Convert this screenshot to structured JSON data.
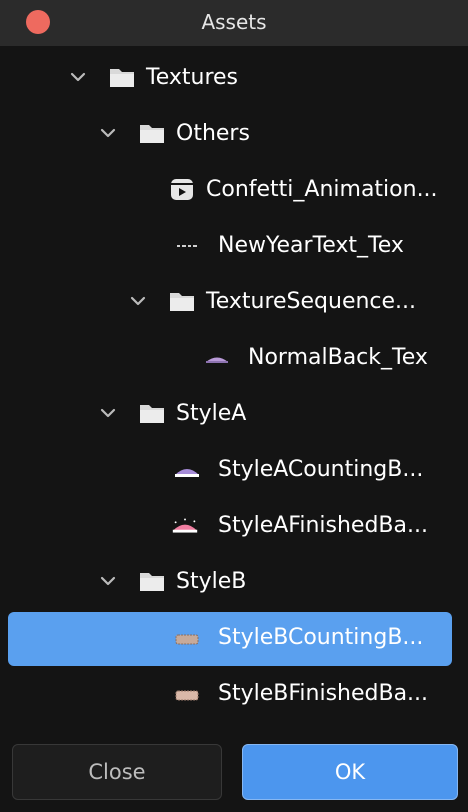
{
  "window": {
    "title": "Assets"
  },
  "tree": {
    "items": [
      {
        "label": "Textures",
        "kind": "folder",
        "expanded": true
      },
      {
        "label": "Others",
        "kind": "folder",
        "expanded": true
      },
      {
        "label": "Confetti_Animation...",
        "kind": "animation"
      },
      {
        "label": "NewYearText_Tex",
        "kind": "texture"
      },
      {
        "label": "TextureSequence...",
        "kind": "folder",
        "expanded": true
      },
      {
        "label": "NormalBack_Tex",
        "kind": "texture"
      },
      {
        "label": "StyleA",
        "kind": "folder",
        "expanded": true
      },
      {
        "label": "StyleACountingB...",
        "kind": "texture"
      },
      {
        "label": "StyleAFinishedBa...",
        "kind": "texture"
      },
      {
        "label": "StyleB",
        "kind": "folder",
        "expanded": true
      },
      {
        "label": "StyleBCountingB...",
        "kind": "texture",
        "selected": true
      },
      {
        "label": "StyleBFinishedBa...",
        "kind": "texture"
      }
    ]
  },
  "buttons": {
    "close_label": "Close",
    "ok_label": "OK"
  },
  "colors": {
    "selection": "#5aa0ef",
    "ok_button": "#4c96ee",
    "close_dot": "#ee6a5f",
    "background": "#141414"
  }
}
